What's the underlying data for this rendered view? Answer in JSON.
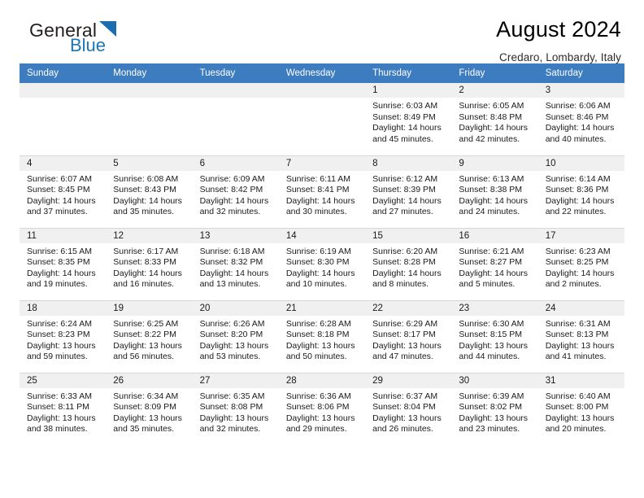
{
  "brand": {
    "word_one": "General",
    "word_two": "Blue"
  },
  "header": {
    "title": "August 2024",
    "subtitle": "Credaro, Lombardy, Italy"
  },
  "colors": {
    "header_blue": "#3d7cbf",
    "brand_blue": "#1b75bb",
    "daynum_bg": "#f0f0f0",
    "grid_line": "#d7d7d7"
  },
  "weekdays": [
    "Sunday",
    "Monday",
    "Tuesday",
    "Wednesday",
    "Thursday",
    "Friday",
    "Saturday"
  ],
  "labels": {
    "sunrise_prefix": "Sunrise: ",
    "sunset_prefix": "Sunset: ",
    "daylight_prefix": "Daylight: "
  },
  "weeks": [
    [
      {
        "day": "",
        "empty": true
      },
      {
        "day": "",
        "empty": true
      },
      {
        "day": "",
        "empty": true
      },
      {
        "day": "",
        "empty": true
      },
      {
        "day": "1",
        "sunrise": "Sunrise: 6:03 AM",
        "sunset": "Sunset: 8:49 PM",
        "daylight": "Daylight: 14 hours and 45 minutes."
      },
      {
        "day": "2",
        "sunrise": "Sunrise: 6:05 AM",
        "sunset": "Sunset: 8:48 PM",
        "daylight": "Daylight: 14 hours and 42 minutes."
      },
      {
        "day": "3",
        "sunrise": "Sunrise: 6:06 AM",
        "sunset": "Sunset: 8:46 PM",
        "daylight": "Daylight: 14 hours and 40 minutes."
      }
    ],
    [
      {
        "day": "4",
        "sunrise": "Sunrise: 6:07 AM",
        "sunset": "Sunset: 8:45 PM",
        "daylight": "Daylight: 14 hours and 37 minutes."
      },
      {
        "day": "5",
        "sunrise": "Sunrise: 6:08 AM",
        "sunset": "Sunset: 8:43 PM",
        "daylight": "Daylight: 14 hours and 35 minutes."
      },
      {
        "day": "6",
        "sunrise": "Sunrise: 6:09 AM",
        "sunset": "Sunset: 8:42 PM",
        "daylight": "Daylight: 14 hours and 32 minutes."
      },
      {
        "day": "7",
        "sunrise": "Sunrise: 6:11 AM",
        "sunset": "Sunset: 8:41 PM",
        "daylight": "Daylight: 14 hours and 30 minutes."
      },
      {
        "day": "8",
        "sunrise": "Sunrise: 6:12 AM",
        "sunset": "Sunset: 8:39 PM",
        "daylight": "Daylight: 14 hours and 27 minutes."
      },
      {
        "day": "9",
        "sunrise": "Sunrise: 6:13 AM",
        "sunset": "Sunset: 8:38 PM",
        "daylight": "Daylight: 14 hours and 24 minutes."
      },
      {
        "day": "10",
        "sunrise": "Sunrise: 6:14 AM",
        "sunset": "Sunset: 8:36 PM",
        "daylight": "Daylight: 14 hours and 22 minutes."
      }
    ],
    [
      {
        "day": "11",
        "sunrise": "Sunrise: 6:15 AM",
        "sunset": "Sunset: 8:35 PM",
        "daylight": "Daylight: 14 hours and 19 minutes."
      },
      {
        "day": "12",
        "sunrise": "Sunrise: 6:17 AM",
        "sunset": "Sunset: 8:33 PM",
        "daylight": "Daylight: 14 hours and 16 minutes."
      },
      {
        "day": "13",
        "sunrise": "Sunrise: 6:18 AM",
        "sunset": "Sunset: 8:32 PM",
        "daylight": "Daylight: 14 hours and 13 minutes."
      },
      {
        "day": "14",
        "sunrise": "Sunrise: 6:19 AM",
        "sunset": "Sunset: 8:30 PM",
        "daylight": "Daylight: 14 hours and 10 minutes."
      },
      {
        "day": "15",
        "sunrise": "Sunrise: 6:20 AM",
        "sunset": "Sunset: 8:28 PM",
        "daylight": "Daylight: 14 hours and 8 minutes."
      },
      {
        "day": "16",
        "sunrise": "Sunrise: 6:21 AM",
        "sunset": "Sunset: 8:27 PM",
        "daylight": "Daylight: 14 hours and 5 minutes."
      },
      {
        "day": "17",
        "sunrise": "Sunrise: 6:23 AM",
        "sunset": "Sunset: 8:25 PM",
        "daylight": "Daylight: 14 hours and 2 minutes."
      }
    ],
    [
      {
        "day": "18",
        "sunrise": "Sunrise: 6:24 AM",
        "sunset": "Sunset: 8:23 PM",
        "daylight": "Daylight: 13 hours and 59 minutes."
      },
      {
        "day": "19",
        "sunrise": "Sunrise: 6:25 AM",
        "sunset": "Sunset: 8:22 PM",
        "daylight": "Daylight: 13 hours and 56 minutes."
      },
      {
        "day": "20",
        "sunrise": "Sunrise: 6:26 AM",
        "sunset": "Sunset: 8:20 PM",
        "daylight": "Daylight: 13 hours and 53 minutes."
      },
      {
        "day": "21",
        "sunrise": "Sunrise: 6:28 AM",
        "sunset": "Sunset: 8:18 PM",
        "daylight": "Daylight: 13 hours and 50 minutes."
      },
      {
        "day": "22",
        "sunrise": "Sunrise: 6:29 AM",
        "sunset": "Sunset: 8:17 PM",
        "daylight": "Daylight: 13 hours and 47 minutes."
      },
      {
        "day": "23",
        "sunrise": "Sunrise: 6:30 AM",
        "sunset": "Sunset: 8:15 PM",
        "daylight": "Daylight: 13 hours and 44 minutes."
      },
      {
        "day": "24",
        "sunrise": "Sunrise: 6:31 AM",
        "sunset": "Sunset: 8:13 PM",
        "daylight": "Daylight: 13 hours and 41 minutes."
      }
    ],
    [
      {
        "day": "25",
        "sunrise": "Sunrise: 6:33 AM",
        "sunset": "Sunset: 8:11 PM",
        "daylight": "Daylight: 13 hours and 38 minutes."
      },
      {
        "day": "26",
        "sunrise": "Sunrise: 6:34 AM",
        "sunset": "Sunset: 8:09 PM",
        "daylight": "Daylight: 13 hours and 35 minutes."
      },
      {
        "day": "27",
        "sunrise": "Sunrise: 6:35 AM",
        "sunset": "Sunset: 8:08 PM",
        "daylight": "Daylight: 13 hours and 32 minutes."
      },
      {
        "day": "28",
        "sunrise": "Sunrise: 6:36 AM",
        "sunset": "Sunset: 8:06 PM",
        "daylight": "Daylight: 13 hours and 29 minutes."
      },
      {
        "day": "29",
        "sunrise": "Sunrise: 6:37 AM",
        "sunset": "Sunset: 8:04 PM",
        "daylight": "Daylight: 13 hours and 26 minutes."
      },
      {
        "day": "30",
        "sunrise": "Sunrise: 6:39 AM",
        "sunset": "Sunset: 8:02 PM",
        "daylight": "Daylight: 13 hours and 23 minutes."
      },
      {
        "day": "31",
        "sunrise": "Sunrise: 6:40 AM",
        "sunset": "Sunset: 8:00 PM",
        "daylight": "Daylight: 13 hours and 20 minutes."
      }
    ]
  ]
}
